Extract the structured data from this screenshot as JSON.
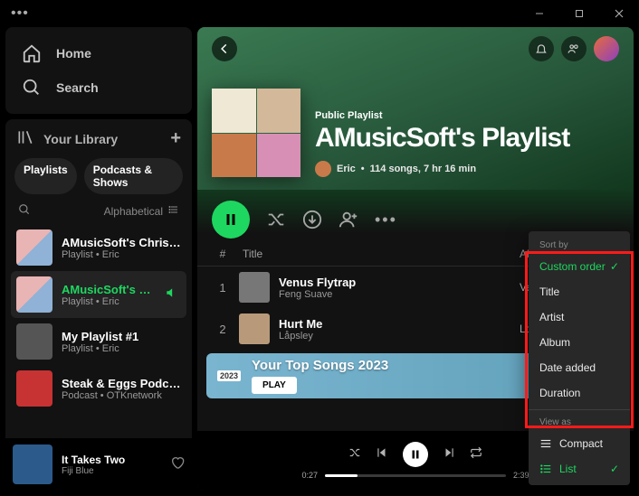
{
  "titlebar": {
    "dots": "•••"
  },
  "nav": {
    "home": "Home",
    "search": "Search"
  },
  "library": {
    "header": "Your Library",
    "chips": [
      "Playlists",
      "Podcasts & Shows"
    ],
    "sort_label": "Alphabetical",
    "items": [
      {
        "title": "AMusicSoft's Christmas...",
        "subtitle": "Playlist • Eric"
      },
      {
        "title": "AMusicSoft's Play...",
        "subtitle": "Playlist • Eric"
      },
      {
        "title": "My Playlist #1",
        "subtitle": "Playlist • Eric"
      },
      {
        "title": "Steak & Eggs Podcast",
        "subtitle": "Podcast • OTKnetwork"
      }
    ]
  },
  "now_playing": {
    "title": "It Takes Two",
    "artist": "Fiji Blue"
  },
  "hero": {
    "kicker": "Public Playlist",
    "title": "AMusicSoft's Playlist",
    "owner": "Eric",
    "stats": "114 songs, 7 hr 16 min"
  },
  "columns": {
    "index": "#",
    "title": "Title",
    "album": "Album"
  },
  "tracks": [
    {
      "num": "1",
      "title": "Venus Flytrap",
      "artist": "Feng Suave",
      "album": "Venus Flytrap"
    },
    {
      "num": "2",
      "title": "Hurt Me",
      "artist": "Låpsley",
      "album": "Long Way Home"
    }
  ],
  "banner": {
    "year": "2023",
    "title": "Your Top Songs 2023",
    "button": "PLAY"
  },
  "player": {
    "elapsed": "0:27",
    "total": "2:39"
  },
  "popup": {
    "sort_label": "Sort by",
    "options": [
      "Custom order",
      "Title",
      "Artist",
      "Album",
      "Date added",
      "Duration"
    ],
    "selected": "Custom order",
    "view_label": "View as",
    "view_compact": "Compact",
    "view_list": "List"
  }
}
